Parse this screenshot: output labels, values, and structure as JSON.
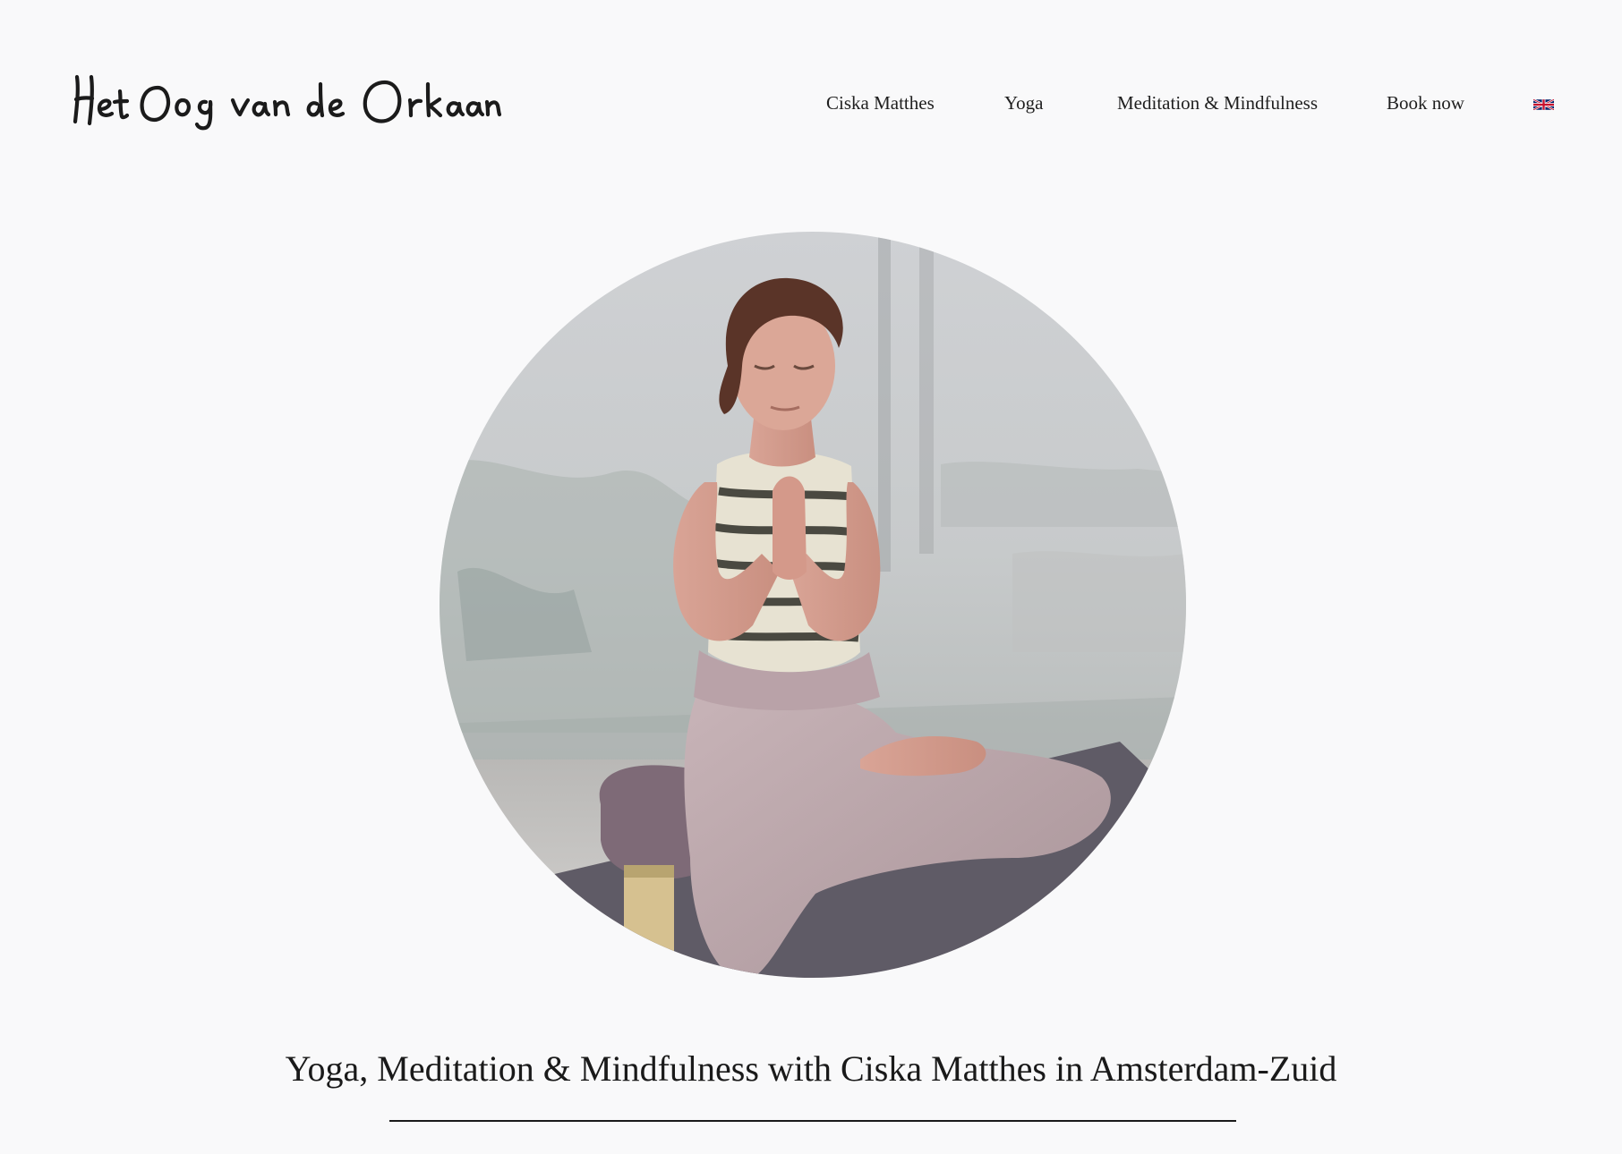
{
  "header": {
    "logo_text": "Het Oog van de Orkaan",
    "nav": [
      {
        "label": "Ciska Matthes"
      },
      {
        "label": "Yoga"
      },
      {
        "label": "Meditation & Mindfulness"
      },
      {
        "label": "Book now"
      }
    ],
    "language": {
      "icon": "uk-flag-icon"
    }
  },
  "hero": {
    "image": "woman-meditating-photo"
  },
  "main": {
    "headline": "Yoga, Meditation & Mindfulness with Ciska Matthes in Amsterdam-Zuid"
  },
  "colors": {
    "background": "#f9f9fa",
    "text": "#1a1a1a"
  }
}
